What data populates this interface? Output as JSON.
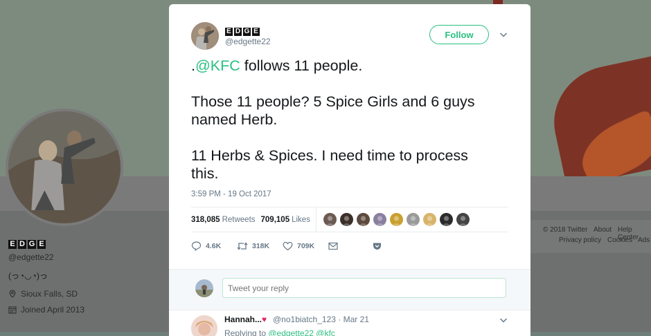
{
  "background_profile": {
    "name_logo_letters": [
      "E",
      "D",
      "G",
      "E"
    ],
    "handle": "@edgette22",
    "bio": "(っ◔◡◔)っ",
    "location": "Sioux Falls, SD",
    "joined": "Joined April 2013",
    "footer_links": [
      "© 2018 Twitter",
      "About",
      "Help Center",
      "Privacy policy",
      "Cookies",
      "Ads"
    ]
  },
  "tweet": {
    "author": {
      "name_logo_letters": [
        "E",
        "D",
        "G",
        "E"
      ],
      "handle": "@edgette22"
    },
    "follow_label": "Follow",
    "text_line1_prefix": ".",
    "text_line1_mention": "@KFC",
    "text_line1_rest": " follows 11 people.",
    "text_para2_line1": "Those 11 people? 5 Spice Girls and 6 guys",
    "text_para2_line2": "named Herb.",
    "text_para3_line1": "11 Herbs & Spices. I need time to process",
    "text_para3_line2": "this.",
    "timestamp": "3:59 PM - 19 Oct 2017",
    "retweets_count": "318,085",
    "retweets_label": "Retweets",
    "likes_count": "709,105",
    "likes_label": "Likes",
    "liker_colors": [
      "#6a5a52",
      "#3c2f2a",
      "#5d4a3e",
      "#8a7fa0",
      "#c9a030",
      "#9a9a9a",
      "#d8b46a",
      "#2b2b2b",
      "#444444"
    ],
    "actions": {
      "reply_count": "4.6K",
      "retweet_count": "318K",
      "like_count": "709K"
    }
  },
  "reply_box": {
    "placeholder": "Tweet your reply"
  },
  "reply": {
    "name": "Hannah...",
    "heart": "♥",
    "meta": "@no1biatch_123 · Mar 21",
    "replying_prefix": "Replying to ",
    "replying_mentions": "@edgette22 @kfc"
  },
  "colors": {
    "accent": "#2bbf81",
    "muted": "#657786",
    "like_red": "#e0245e"
  }
}
